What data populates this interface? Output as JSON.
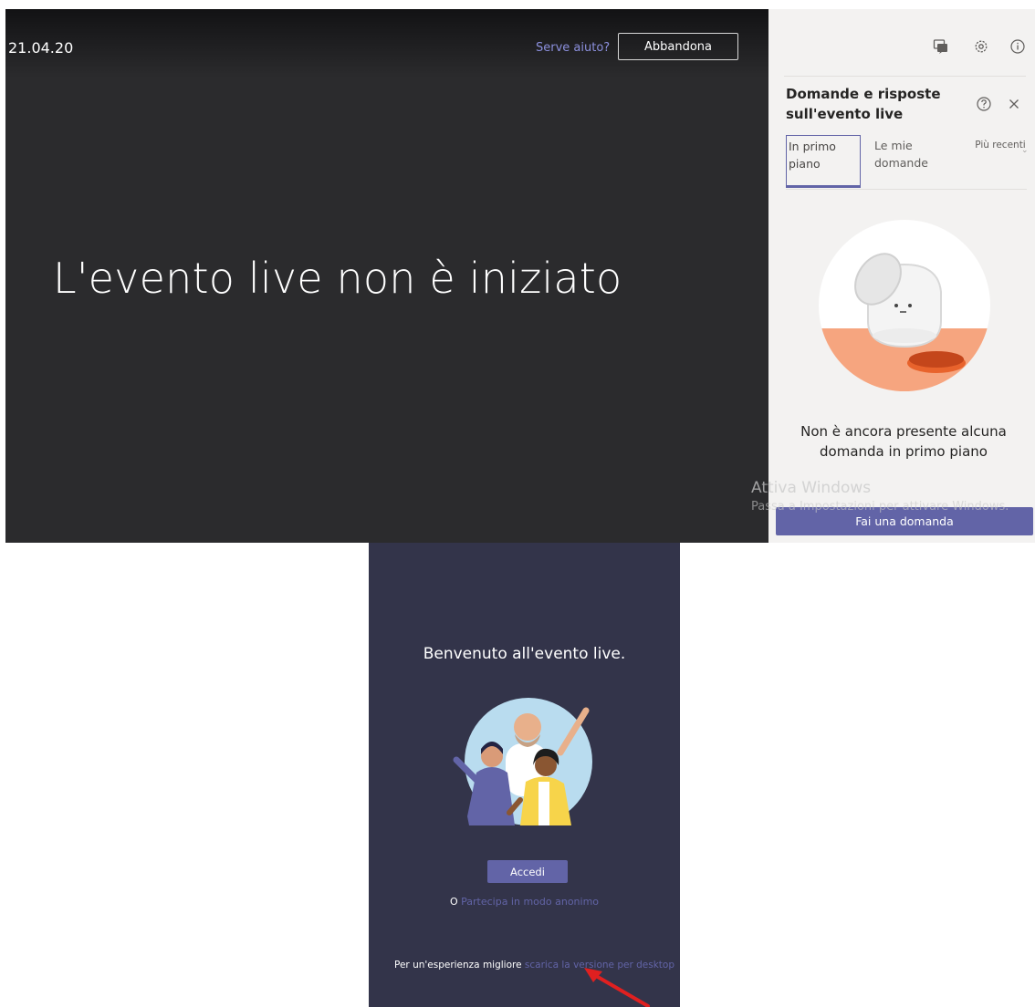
{
  "stage": {
    "date": "21.04.20",
    "help_link": "Serve aiuto?",
    "leave_label": "Abbandona",
    "message": "L'evento live non è iniziato"
  },
  "qa_panel": {
    "icons": [
      "qa-icon",
      "gear-icon",
      "info-icon"
    ],
    "title": "Domande e risposte sull'evento live",
    "tabs": [
      {
        "label": "In primo piano",
        "selected": true
      },
      {
        "label": "Le mie domande",
        "selected": false
      }
    ],
    "sort_label": "Più recenti",
    "empty_message": "Non è ancora presente alcuna domanda in primo piano",
    "ask_button": "Fai una domanda"
  },
  "watermark": {
    "title": "Attiva Windows",
    "subtitle": "Passa a Impostazioni per attivare Windows."
  },
  "mobile": {
    "welcome": "Benvenuto all'evento live.",
    "signin_label": "Accedi",
    "anon_prefix": "O",
    "anon_link": "Partecipa in modo anonimo",
    "desktop_prefix": "Per un'esperienza migliore",
    "desktop_link": "scarica la versione per desktop"
  },
  "colors": {
    "accent": "#6264a7",
    "stage_bg": "#2b2b2d",
    "panel_bg": "#f3f2f1",
    "mobile_bg": "#33344a",
    "arrow": "#e02020"
  }
}
